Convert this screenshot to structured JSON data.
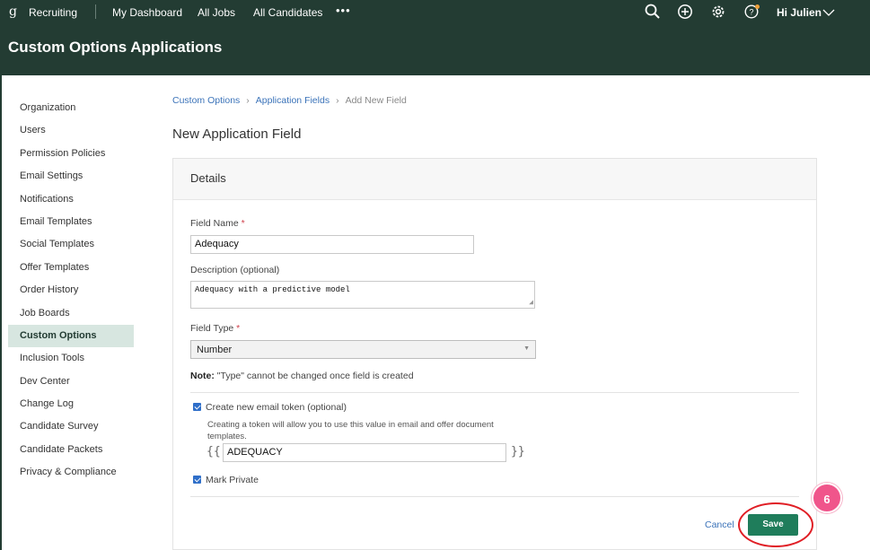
{
  "topnav": {
    "logo": "g",
    "brand": "Recruiting",
    "links": [
      "My Dashboard",
      "All Jobs",
      "All Candidates"
    ],
    "more": "•••",
    "greeting": "Hi Julien"
  },
  "header": {
    "title": "Custom Options Applications"
  },
  "sidebar": {
    "items": [
      "Organization",
      "Users",
      "Permission Policies",
      "Email Settings",
      "Notifications",
      "Email Templates",
      "Social Templates",
      "Offer Templates",
      "Order History",
      "Job Boards",
      "Custom Options",
      "Inclusion Tools",
      "Dev Center",
      "Change Log",
      "Candidate Survey",
      "Candidate Packets",
      "Privacy & Compliance"
    ],
    "active": "Custom Options"
  },
  "breadcrumb": {
    "items": [
      "Custom Options",
      "Application Fields",
      "Add New Field"
    ],
    "separator": "›"
  },
  "page": {
    "title": "New Application Field"
  },
  "card": {
    "title": "Details",
    "field_name": {
      "label": "Field Name",
      "required_mark": "*",
      "value": "Adequacy"
    },
    "description": {
      "label": "Description (optional)",
      "value": "Adequacy with a predictive model"
    },
    "field_type": {
      "label": "Field Type",
      "required_mark": "*",
      "value": "Number"
    },
    "note": {
      "bold": "Note:",
      "text": " \"Type\" cannot be changed once field is created"
    },
    "email_token": {
      "label": "Create new email token (optional)",
      "checked": true,
      "help": "Creating a token will allow you to use this value in email and offer document templates.",
      "open_brace": "{{",
      "close_brace": "}}",
      "value": "ADEQUACY"
    },
    "mark_private": {
      "label": "Mark Private",
      "checked": true
    },
    "cancel": "Cancel",
    "save": "Save"
  },
  "annotation": {
    "step": "6",
    "ring_color": "#e01e25",
    "badge_color": "#f0558b"
  },
  "colors": {
    "header_bg": "#233c33",
    "active_item_bg": "#d7e6e0",
    "link": "#3b73b9",
    "save_bg": "#1f7d5b",
    "checkbox": "#2f6fc9"
  }
}
